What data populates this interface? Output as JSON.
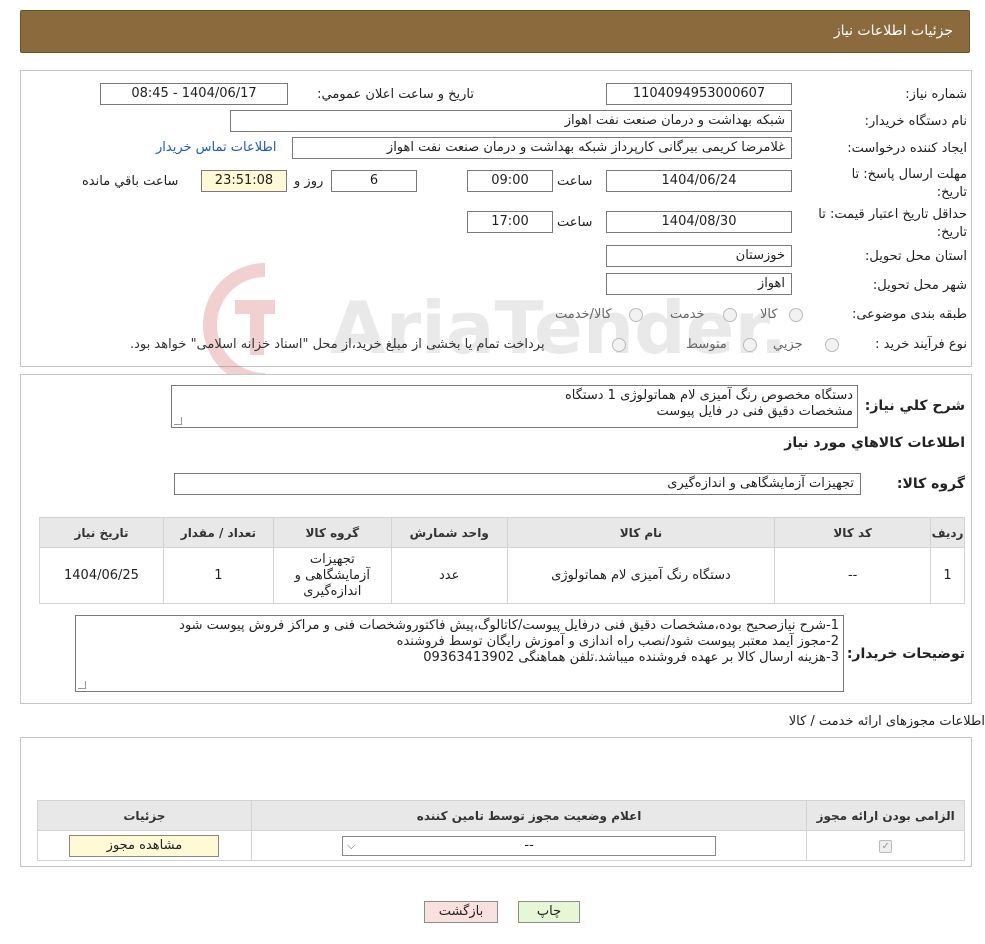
{
  "header": {
    "title": "جزئیات اطلاعات نیاز"
  },
  "form": {
    "need_number_label": "شماره نیاز:",
    "need_number": "1104094953000607",
    "announce_label": "تاریخ و ساعت اعلان عمومي:",
    "announce_value": "1404/06/17 - 08:45",
    "buyer_label": "نام دستگاه خريدار:",
    "buyer_value": "شبکه بهداشت و درمان صنعت نفت اهواز",
    "requester_label": "ايجاد کننده درخواست:",
    "requester_value": "غلامرضا کریمی بیرگانی کارپرداز شبکه بهداشت و درمان صنعت نفت اهواز",
    "contact_link": "اطلاعات تماس خريدار",
    "deadline_label": "مهلت ارسال پاسخ: تا تاريخ:",
    "deadline_date": "1404/06/24",
    "time_label": "ساعت",
    "deadline_time": "09:00",
    "days_value": "6",
    "days_label": "روز و",
    "remaining_value": "23:51:08",
    "remaining_label": "ساعت باقي مانده",
    "validity_label": "حداقل تاريخ اعتبار قيمت: تا تاريخ:",
    "validity_date": "1404/08/30",
    "validity_time": "17:00",
    "province_label": "استان محل تحويل:",
    "province_value": "خوزستان",
    "city_label": "شهر محل تحويل:",
    "city_value": "اهواز",
    "category_label": "طبقه بندی موضوعی:",
    "category_options": [
      "کالا",
      "خدمت",
      "کالا/خدمت"
    ],
    "process_label": "نوع فرآيند خريد :",
    "process_options": [
      "جزيي",
      "متوسط"
    ],
    "process_note": "پرداخت تمام یا بخشی از مبلغ خرید،از محل \"اسناد خزانه اسلامی\" خواهد بود."
  },
  "summary": {
    "label": "شرح کلي نياز:",
    "line1": "دستگاه مخصوص رنگ آمیزی لام هماتولوژی      1 دستگاه",
    "line2": "مشخصات دقیق فنی در فایل پیوست",
    "goods_info_title": "اطلاعات کالاهاي مورد نياز",
    "group_label": "گروه کالا:",
    "group_value": "تجهیزات آزمایشگاهی و اندازه‌گیری"
  },
  "items_table": {
    "headers": [
      "رديف",
      "کد کالا",
      "نام کالا",
      "واحد شمارش",
      "گروه کالا",
      "تعداد / مقدار",
      "تاريخ نياز"
    ],
    "rows": [
      [
        "1",
        "--",
        "دستگاه رنگ آمیزی لام هماتولوژی",
        "عدد",
        "تجهیزات آزمایشگاهی و اندازه‌گیری",
        "1",
        "1404/06/25"
      ]
    ]
  },
  "buyer_notes": {
    "label": "توضيحات خريدار:",
    "line1": "1-شرح نیازصحیح بوده،مشخصات دقیق فنی درفایل پیوست/کاتالوگ،پیش فاکتوروشخصات فنی و مراکز فروش پیوست شود",
    "line2": "2-مجوز آیمد معتبر پیوست شود/نصب راه اندازی و آموزش رایگان توسط فروشنده",
    "line3": "3-هزینه ارسال کالا بر عهده فروشنده میباشد.تلفن هماهنگی 09363413902"
  },
  "permits": {
    "title": "اطلاعات مجوزهای ارائه خدمت / کالا",
    "headers": [
      "الزامی بودن ارائه مجوز",
      "اعلام وضعیت مجوز توسط تامین کننده",
      "جزئیات"
    ],
    "select_value": "--",
    "view_button": "مشاهده مجوز"
  },
  "footer": {
    "print_button": "چاپ",
    "back_button": "بازگشت"
  },
  "watermark": {
    "text": "AriaTender.neT"
  },
  "colors": {
    "header_bg": "#8b6a3d",
    "link": "#1f57c8",
    "yellow_box": "#fff9d6",
    "print_btn": "#e6f7d6",
    "back_btn": "#fbe0e0"
  }
}
